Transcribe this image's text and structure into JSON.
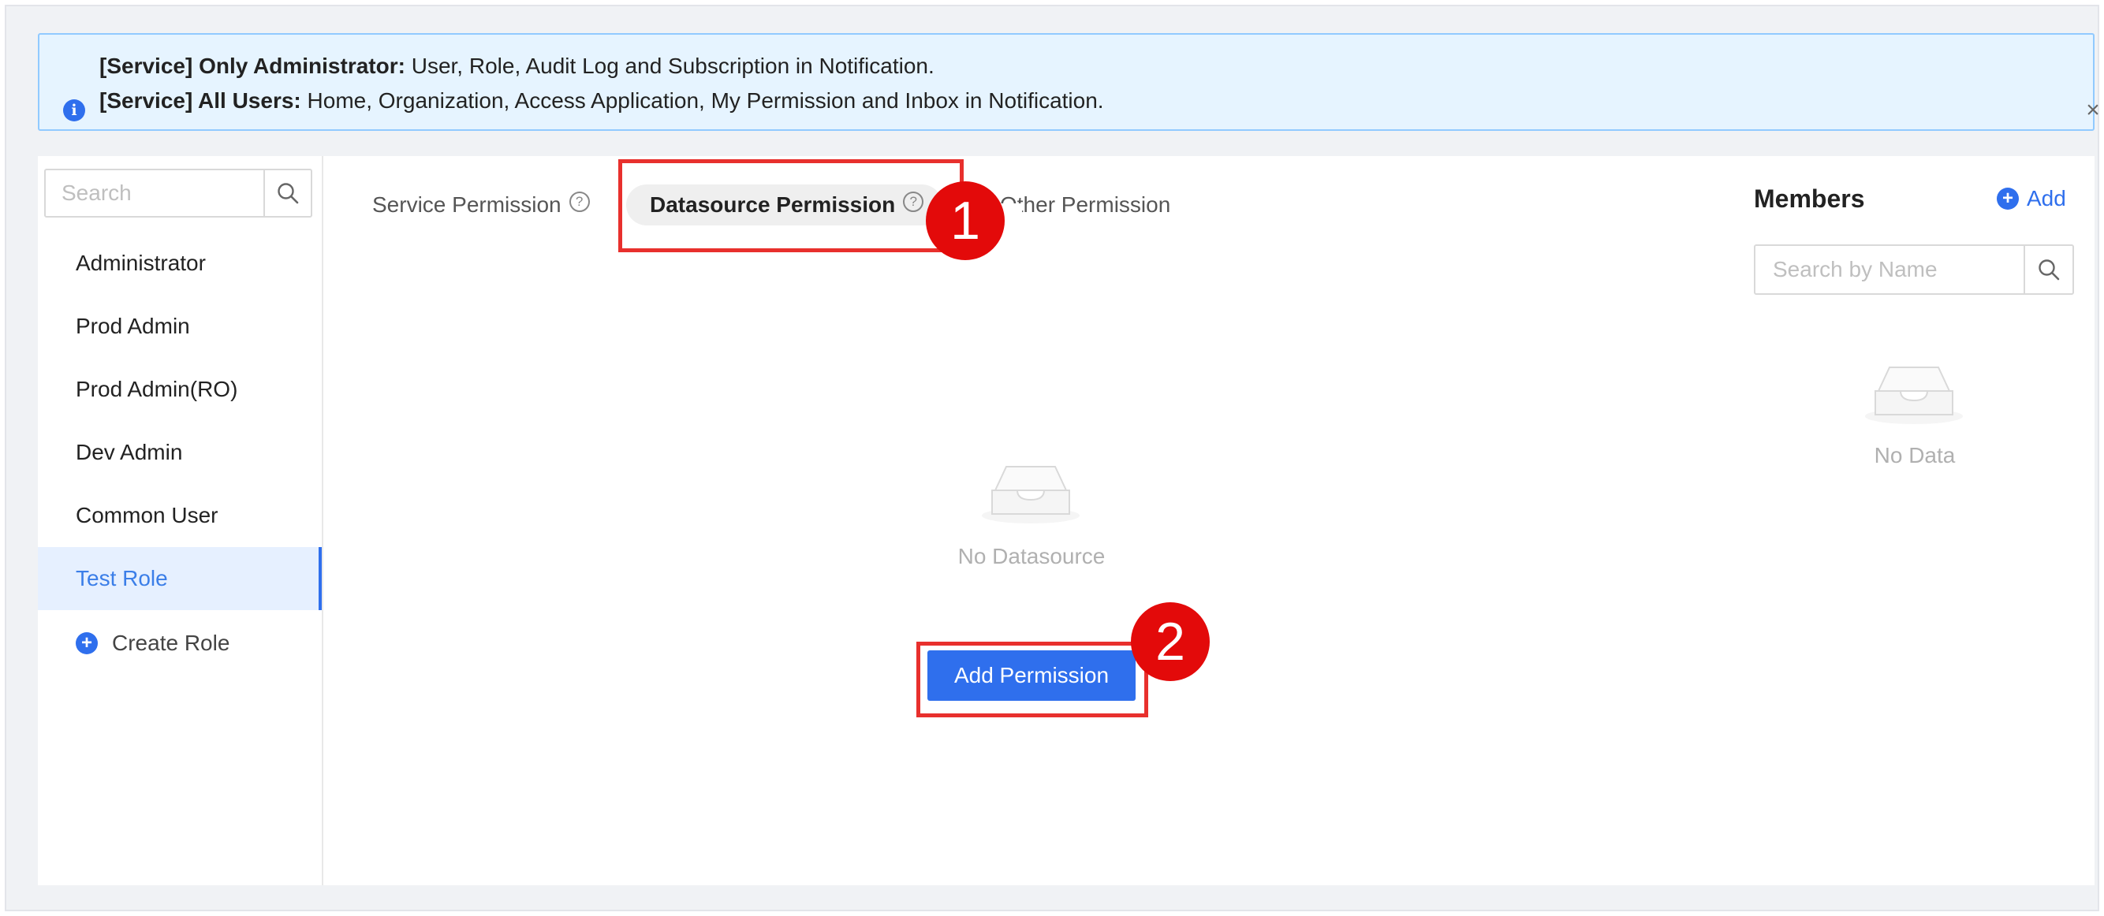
{
  "notice": {
    "line1_bold": "[Service] Only Administrator:",
    "line1_text": " User, Role, Audit Log and Subscription in Notification.",
    "line2_bold": "[Service] All Users:",
    "line2_text": " Home, Organization, Access Application, My Permission and Inbox in Notification.",
    "info_icon": "i",
    "close_icon": "×"
  },
  "sidebar": {
    "search_placeholder": "Search",
    "roles": [
      {
        "label": "Administrator"
      },
      {
        "label": "Prod Admin"
      },
      {
        "label": "Prod Admin(RO)"
      },
      {
        "label": "Dev Admin"
      },
      {
        "label": "Common User"
      },
      {
        "label": "Test Role",
        "active": true
      }
    ],
    "create_role_label": "Create Role"
  },
  "tabs": [
    {
      "label": "Service Permission",
      "help_icon": "?"
    },
    {
      "label": "Datasource Permission",
      "help_icon": "?",
      "active": true
    },
    {
      "label": "Other Permission"
    }
  ],
  "main": {
    "empty_text": "No Datasource",
    "add_permission_label": "Add Permission"
  },
  "members": {
    "title": "Members",
    "add_label": "Add",
    "search_placeholder": "Search by Name",
    "empty_text": "No Data"
  },
  "annotations": {
    "marker1": "1",
    "marker2": "2"
  },
  "colors": {
    "accent": "#2f6fed",
    "highlight": "#e8302d",
    "marker": "#e30a0a",
    "notice_bg": "#e6f4ff"
  }
}
